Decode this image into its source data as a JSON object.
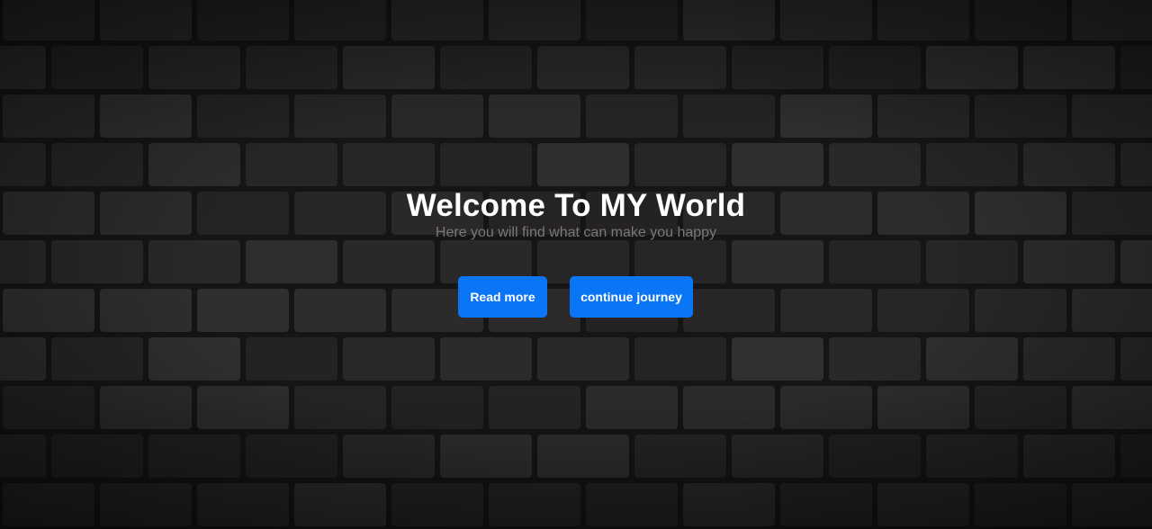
{
  "hero": {
    "title": "Welcome To MY World",
    "subtitle": "Here you will find what can make you happy",
    "buttons": [
      {
        "label": "Read more"
      },
      {
        "label": "continue journey"
      }
    ]
  },
  "colors": {
    "background": "#222020",
    "brick": "#2b2929",
    "mortar": "#161515",
    "title": "#ffffff",
    "subtitle": "#7b7877",
    "button": "#0a76f5",
    "button_text": "#ffffff"
  }
}
